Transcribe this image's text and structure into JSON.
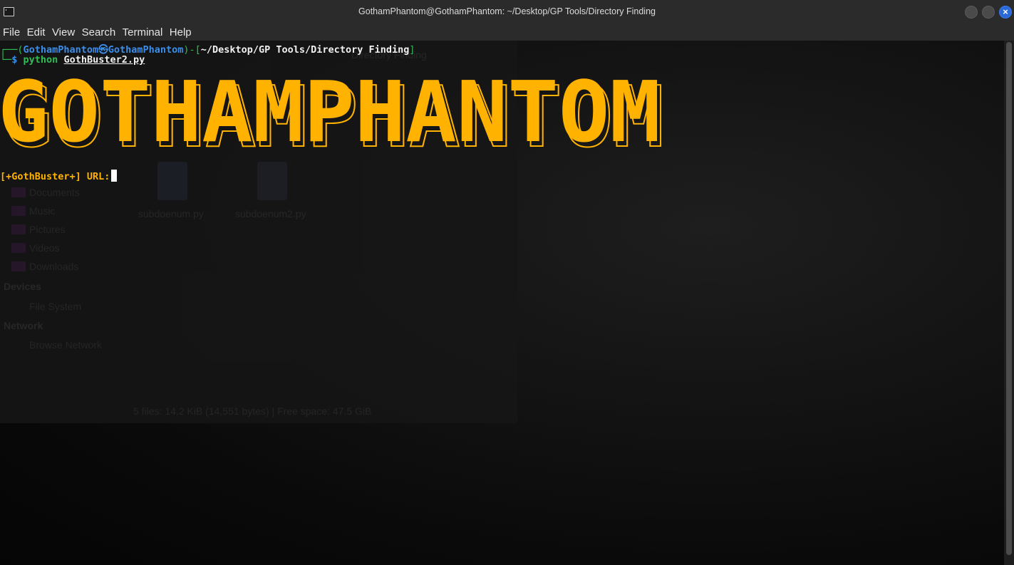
{
  "window": {
    "title": "GothamPhantom@GothamPhantom: ~/Desktop/GP Tools/Directory Finding"
  },
  "menu": [
    "File",
    "Edit",
    "View",
    "Search",
    "Terminal",
    "Help"
  ],
  "prompt": {
    "open": "┌──(",
    "user": "GothamPhantom",
    "at": "㉿",
    "host": "GothamPhantom",
    "mid": ")-[",
    "path": "~/Desktop/GP Tools/Directory Finding",
    "close": "]",
    "second_prefix": "└─",
    "dollar": "$",
    "command": "python",
    "argument": "GothBuster2.py"
  },
  "banner": {
    "text": "GOTHAMPHANTOM",
    "color": "#ffb300"
  },
  "input_prompt": "[+GothBuster+] URL:",
  "background_file_manager": {
    "toolbar_label": "Directory Finding",
    "places": [
      "Documents",
      "Music",
      "Pictures",
      "Videos",
      "Downloads"
    ],
    "devices_header": "Devices",
    "devices": [
      "File System"
    ],
    "network_header": "Network",
    "network": [
      "Browse Network"
    ],
    "files": [
      "subdoenum.py",
      "subdoenum2.py"
    ],
    "status": "5 files: 14.2 KiB (14,551 bytes) | Free space: 47.5 GiB"
  },
  "colors": {
    "accent": "#ffb300",
    "prompt_blue": "#3b8eea",
    "prompt_green": "#2fbf55",
    "close_button": "#2a6ad8"
  }
}
